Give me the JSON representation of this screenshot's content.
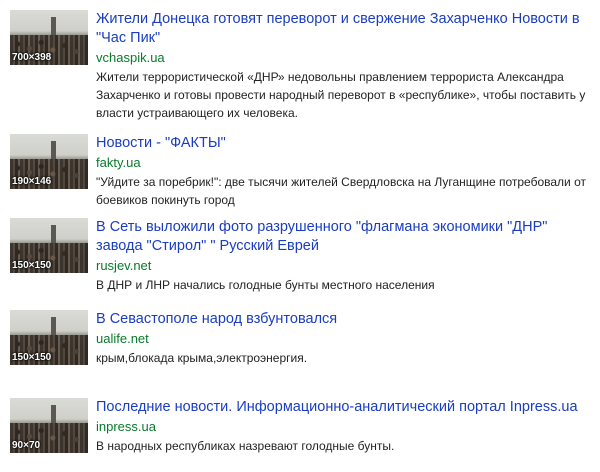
{
  "results": [
    {
      "size": "700×398",
      "title": "Жители Донецка готовят переворот и свержение Захарченко Новости в \"Час Пик\"",
      "domain": "vchaspik.ua",
      "snippet": "Жители террористической «ДНР» недовольны правлением террориста Александра Захарченко и готовы провести народный переворот в «республике», чтобы поставить у власти устраивающего их человека."
    },
    {
      "size": "190×146",
      "title": "Новости - \"ФАКТЫ\"",
      "domain": "fakty.ua",
      "snippet": "\"Уйдите за поребрик!\": две тысячи жителей Свердловска на Луганщине потребовали от боевиков покинуть город"
    },
    {
      "size": "150×150",
      "title": "В Сеть выложили фото разрушенного \"флагмана экономики \"ДНР\" завода \"Стирол\" \" Русский Еврей",
      "domain": "rusjev.net",
      "snippet": "В ДНР и ЛНР начались голодные бунты местного населения"
    },
    {
      "size": "150×150",
      "title": "В Севастополе народ взбунтовался",
      "domain": "ualife.net",
      "snippet": "крым,блокада крыма,электроэнергия."
    },
    {
      "size": "90×70",
      "title": "Последние новости. Информационно-аналитический портал Inpress.ua",
      "domain": "inpress.ua",
      "snippet": "В народных республиках назревают голодные бунты."
    }
  ]
}
